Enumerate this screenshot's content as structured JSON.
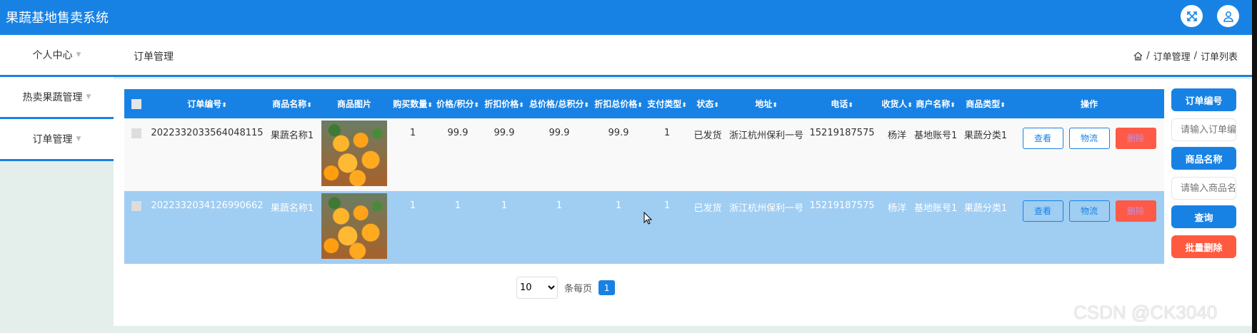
{
  "app": {
    "title": "果蔬基地售卖系统",
    "accent": "#1882e4",
    "danger": "#ff5a47"
  },
  "sidebar": {
    "items": [
      {
        "label": "个人中心"
      },
      {
        "label": "热卖果蔬管理"
      },
      {
        "label": "订单管理"
      }
    ]
  },
  "header_icons": [
    "fullscreen-icon",
    "user-icon"
  ],
  "page": {
    "title": "订单管理",
    "breadcrumb": [
      "订单管理",
      "订单列表"
    ],
    "sep": "/"
  },
  "table": {
    "columns": [
      "订单编号",
      "商品名称",
      "商品图片",
      "购买数量",
      "价格/积分",
      "折扣价格",
      "总价格/总积分",
      "折扣总价格",
      "支付类型",
      "状态",
      "地址",
      "电话",
      "收货人",
      "商户名称",
      "商品类型",
      "操作"
    ],
    "rows": [
      {
        "order_no": "2022332033564048115",
        "name": "果蔬名称1",
        "qty": "1",
        "price": "99.9",
        "disc": "99.9",
        "total": "99.9",
        "disc_total": "99.9",
        "pay_type": "1",
        "status": "已发货",
        "address": "浙江杭州保利一号",
        "phone": "15219187575",
        "receiver": "杨洋",
        "merchant": "基地账号1",
        "type": "果蔬分类1"
      },
      {
        "order_no": "2022332034126990662",
        "name": "果蔬名称1",
        "qty": "1",
        "price": "1",
        "disc": "1",
        "total": "1",
        "disc_total": "1",
        "pay_type": "1",
        "status": "已发货",
        "address": "浙江杭州保利一号",
        "phone": "15219187575",
        "receiver": "杨洋",
        "merchant": "基地账号1",
        "type": "果蔬分类1"
      }
    ],
    "actions": {
      "view": "查看",
      "logistics": "物流",
      "delete": "删除"
    }
  },
  "search": {
    "order_label": "订单编号",
    "order_placeholder": "请输入订单编号",
    "name_label": "商品名称",
    "name_placeholder": "请输入商品名称",
    "query": "查询",
    "batch_delete": "批量删除"
  },
  "pagination": {
    "page_size": "10",
    "per_page_label": "条每页",
    "current_page": "1"
  },
  "watermark": "CSDN @CK3040"
}
